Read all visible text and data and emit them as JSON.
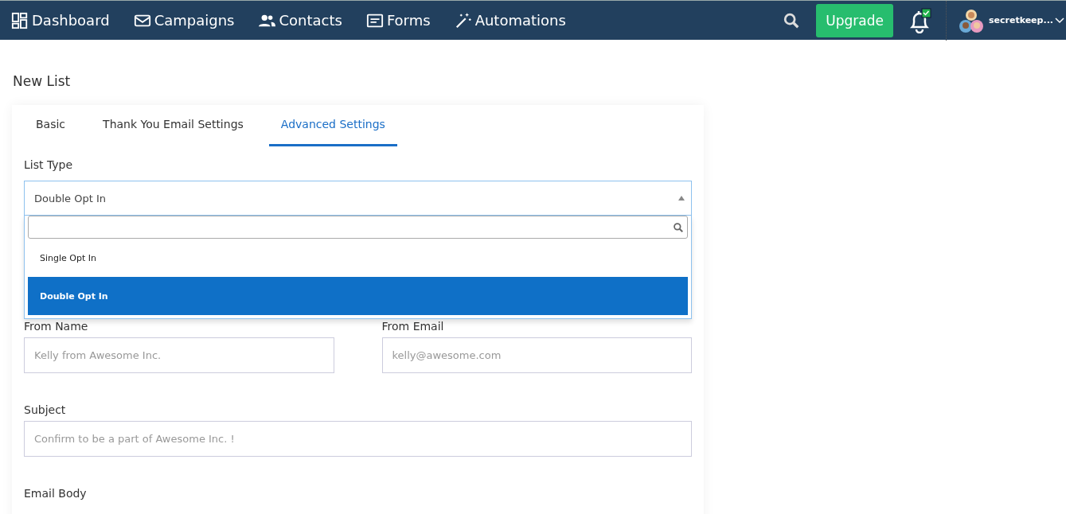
{
  "navbar": {
    "items": [
      {
        "label": "Dashboard",
        "kind": "dashboard"
      },
      {
        "label": "Campaigns",
        "kind": "mail"
      },
      {
        "label": "Contacts",
        "kind": "people"
      },
      {
        "label": "Forms",
        "kind": "form"
      },
      {
        "label": "Automations",
        "kind": "wand"
      }
    ],
    "upgrade": "Upgrade",
    "notification_checked": true,
    "user": "secretkeep..."
  },
  "page_title": "New List",
  "tabs": [
    {
      "label": "Basic",
      "selected": false
    },
    {
      "label": "Thank You Email Settings",
      "selected": false
    },
    {
      "label": "Advanced Settings",
      "selected": true
    }
  ],
  "list_type": {
    "label": "List Type",
    "value": "Double Opt In",
    "expanded": true,
    "options": [
      {
        "label": "Single Opt In",
        "selected": false
      },
      {
        "label": "Double Opt In",
        "selected": true
      }
    ]
  },
  "from_name": {
    "label": "From Name",
    "placeholder": "Kelly from Awesome Inc."
  },
  "from_email": {
    "label": "From Email",
    "placeholder": "kelly@awesome.com"
  },
  "subject": {
    "label": "Subject",
    "placeholder": "Confirm to be a part of Awesome Inc. !"
  },
  "email_body": {
    "label": "Email Body"
  }
}
